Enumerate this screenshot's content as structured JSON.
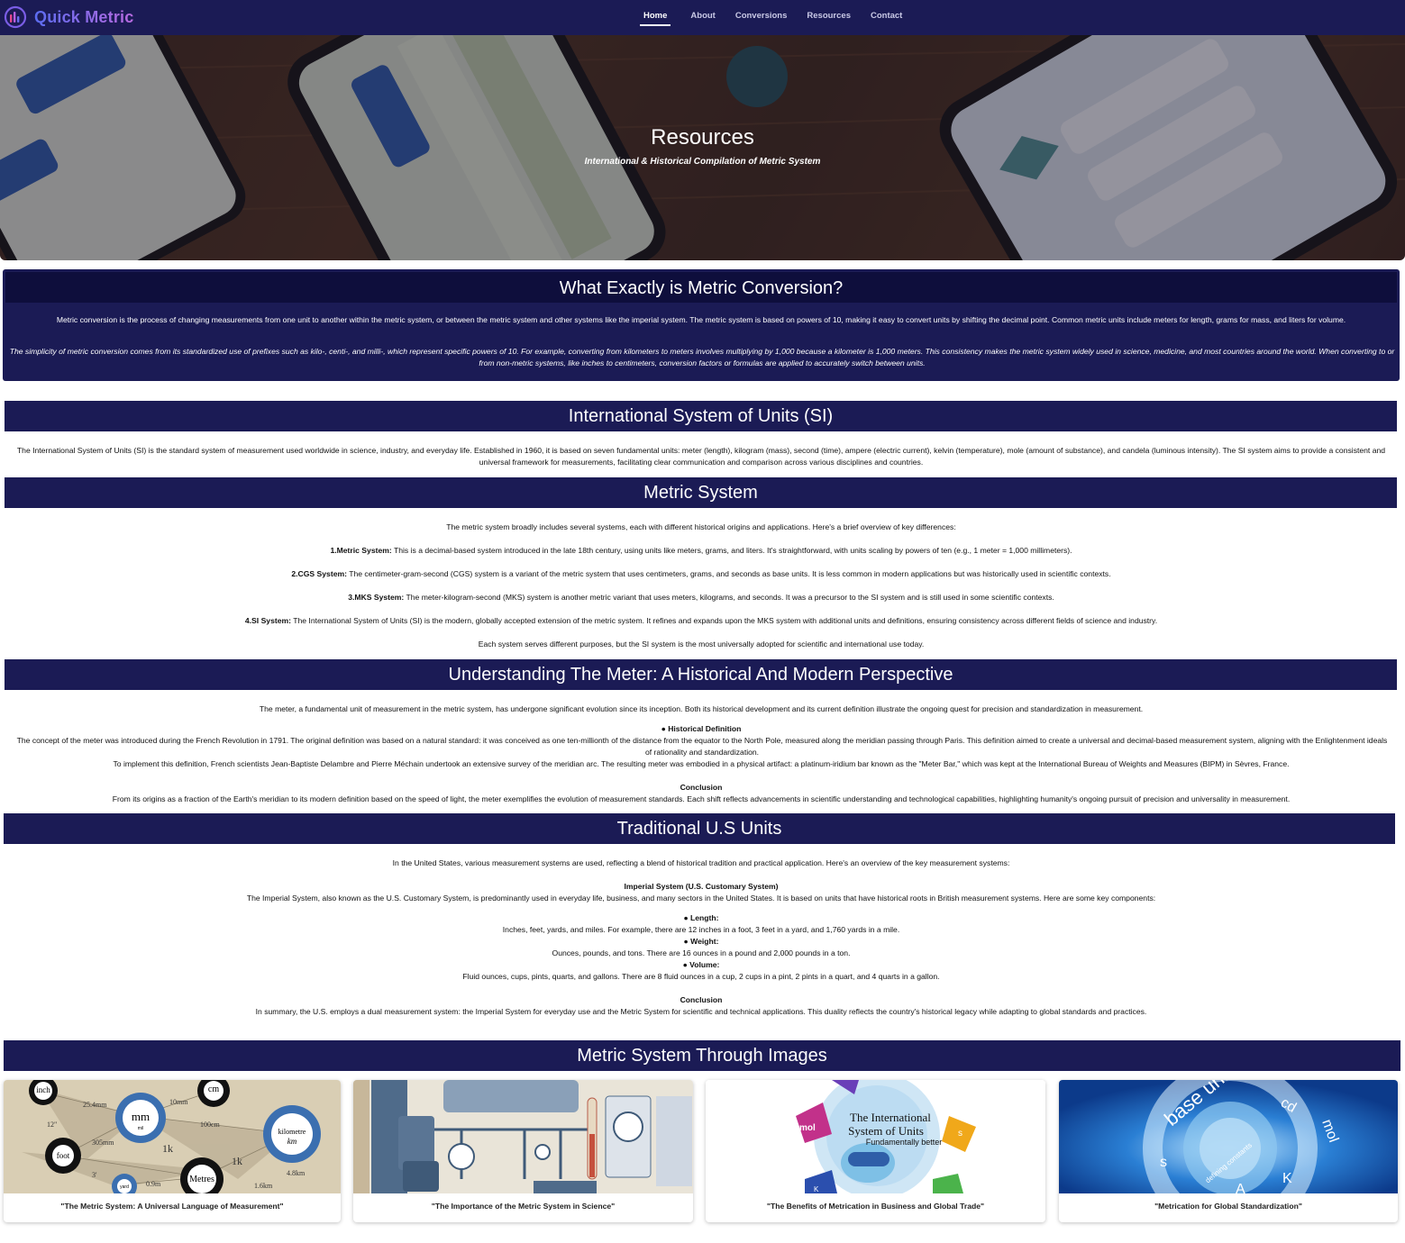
{
  "nav": {
    "brand": "Quick Metric",
    "links": [
      "Home",
      "About",
      "Conversions",
      "Resources",
      "Contact"
    ]
  },
  "hero": {
    "title": "Resources",
    "subtitle": "International & Historical Compilation of Metric System"
  },
  "intro": {
    "heading": "What Exactly is Metric Conversion?",
    "p1": "Metric conversion is the process of changing measurements from one unit to another within the metric system, or between the metric system and other systems like the imperial system. The metric system is based on powers of 10, making it easy to convert units by shifting the decimal point. Common metric units include meters for length, grams for mass, and liters for volume.",
    "p2": "The simplicity of metric conversion comes from its standardized use of prefixes such as kilo-, centi-, and milli-, which represent specific powers of 10. For example, converting from kilometers to meters involves multiplying by 1,000 because a kilometer is 1,000 meters. This consistency makes the metric system widely used in science, medicine, and most countries around the world. When converting to or from non-metric systems, like inches to centimeters, conversion factors or formulas are applied to accurately switch between units."
  },
  "si": {
    "heading": "International System of Units (SI)",
    "text": "The International System of Units (SI) is the standard system of measurement used worldwide in science, industry, and everyday life. Established in 1960, it is based on seven fundamental units: meter (length), kilogram (mass), second (time), ampere (electric current), kelvin (temperature), mole (amount of substance), and candela (luminous intensity). The SI system aims to provide a consistent and universal framework for measurements, facilitating clear communication and comparison across various disciplines and countries."
  },
  "metric": {
    "heading": "Metric System",
    "intro": "The metric system broadly includes several systems, each with different historical origins and applications. Here's a brief overview of key differences:",
    "items": [
      {
        "label": "1.Metric System:",
        "text": " This is a decimal-based system introduced in the late 18th century, using units like meters, grams, and liters. It's straightforward, with units scaling by powers of ten (e.g., 1 meter = 1,000 millimeters)."
      },
      {
        "label": "2.CGS System:",
        "text": " The centimeter-gram-second (CGS) system is a variant of the metric system that uses centimeters, grams, and seconds as base units. It is less common in modern applications but was historically used in scientific contexts."
      },
      {
        "label": "3.MKS System:",
        "text": " The meter-kilogram-second (MKS) system is another metric variant that uses meters, kilograms, and seconds. It was a precursor to the SI system and is still used in some scientific contexts."
      },
      {
        "label": "4.SI System:",
        "text": " The International System of Units (SI) is the modern, globally accepted extension of the metric system. It refines and expands upon the MKS system with additional units and definitions, ensuring consistency across different fields of science and industry."
      }
    ],
    "outro": "Each system serves different purposes, but the SI system is the most universally adopted for scientific and international use today."
  },
  "meter": {
    "heading": "Understanding The Meter: A Historical And Modern Perspective",
    "intro": "The meter, a fundamental unit of measurement in the metric system, has undergone significant evolution since its inception. Both its historical development and its current definition illustrate the ongoing quest for precision and standardization in measurement.",
    "hist_label": "● Historical Definition",
    "hist_p1": "The concept of the meter was introduced during the French Revolution in 1791. The original definition was based on a natural standard: it was conceived as one ten-millionth of the distance from the equator to the North Pole, measured along the meridian passing through Paris. This definition aimed to create a universal and decimal-based measurement system, aligning with the Enlightenment ideals of rationality and standardization.",
    "hist_p2": "To implement this definition, French scientists Jean-Baptiste Delambre and Pierre Méchain undertook an extensive survey of the meridian arc. The resulting meter was embodied in a physical artifact: a platinum-iridium bar known as the \"Meter Bar,\" which was kept at the International Bureau of Weights and Measures (BIPM) in Sèvres, France.",
    "conclusion_label": "Conclusion",
    "conclusion": "From its origins as a fraction of the Earth's meridian to its modern definition based on the speed of light, the meter exemplifies the evolution of measurement standards. Each shift reflects advancements in scientific understanding and technological capabilities, highlighting humanity's ongoing pursuit of precision and universality in measurement."
  },
  "us": {
    "heading": "Traditional U.S Units",
    "intro": "In the United States, various measurement systems are used, reflecting a blend of historical tradition and practical application. Here's an overview of the key measurement systems:",
    "imperial_label": "Imperial System (U.S. Customary System)",
    "imperial_text": "The Imperial System, also known as the U.S. Customary System, is predominantly used in everyday life, business, and many sectors in the United States. It is based on units that have historical roots in British measurement systems. Here are some key components:",
    "length_label": "● Length:",
    "length_text": "Inches, feet, yards, and miles. For example, there are 12 inches in a foot, 3 feet in a yard, and 1,760 yards in a mile.",
    "weight_label": "● Weight:",
    "weight_text": "Ounces, pounds, and tons. There are 16 ounces in a pound and 2,000 pounds in a ton.",
    "volume_label": "● Volume:",
    "volume_text": "Fluid ounces, cups, pints, quarts, and gallons. There are 8 fluid ounces in a cup, 2 cups in a pint, 2 pints in a quart, and 4 quarts in a gallon.",
    "conclusion_label": "Conclusion",
    "conclusion": "In summary, the U.S. employs a dual measurement system: the Imperial System for everyday use and the Metric System for scientific and technical applications. This duality reflects the country's historical legacy while adapting to global standards and practices."
  },
  "gallery": {
    "heading": "Metric System Through Images",
    "captions": [
      "\"The Metric System: A Universal Language of Measurement\"",
      "\"The Importance of the Metric System in Science\"",
      "\"The Benefits of Metrication in Business and Global Trade\"",
      "\"Metrication for Global Standardization\""
    ],
    "img1_labels": {
      "inch": "inch",
      "cm": "cm",
      "mm": "mm",
      "foot": "foot",
      "kilometre": "kilometre",
      "km": "km",
      "metres": "Metres",
      "mm_val": "25.4mm",
      "val_10mm": "10mm",
      "val_100cm": "100cm",
      "val_305mm": "305mm",
      "val_1k": "1k",
      "val_12": "12\"",
      "val_3": "3'",
      "val_09m": "0.9m",
      "val_16km": "1.6km",
      "val_48km": "4.8km",
      "yard": "yard",
      "mil": "mil"
    },
    "img3_labels": {
      "title1": "The International",
      "title2": "System of Units",
      "title3": "Fundamentally better",
      "mol": "mol",
      "s": "s",
      "k": "K"
    },
    "img4_labels": {
      "base": "base units",
      "mol": "mol",
      "cd": "cd",
      "s": "s",
      "a": "A",
      "k": "K",
      "defining": "defining constants"
    }
  }
}
